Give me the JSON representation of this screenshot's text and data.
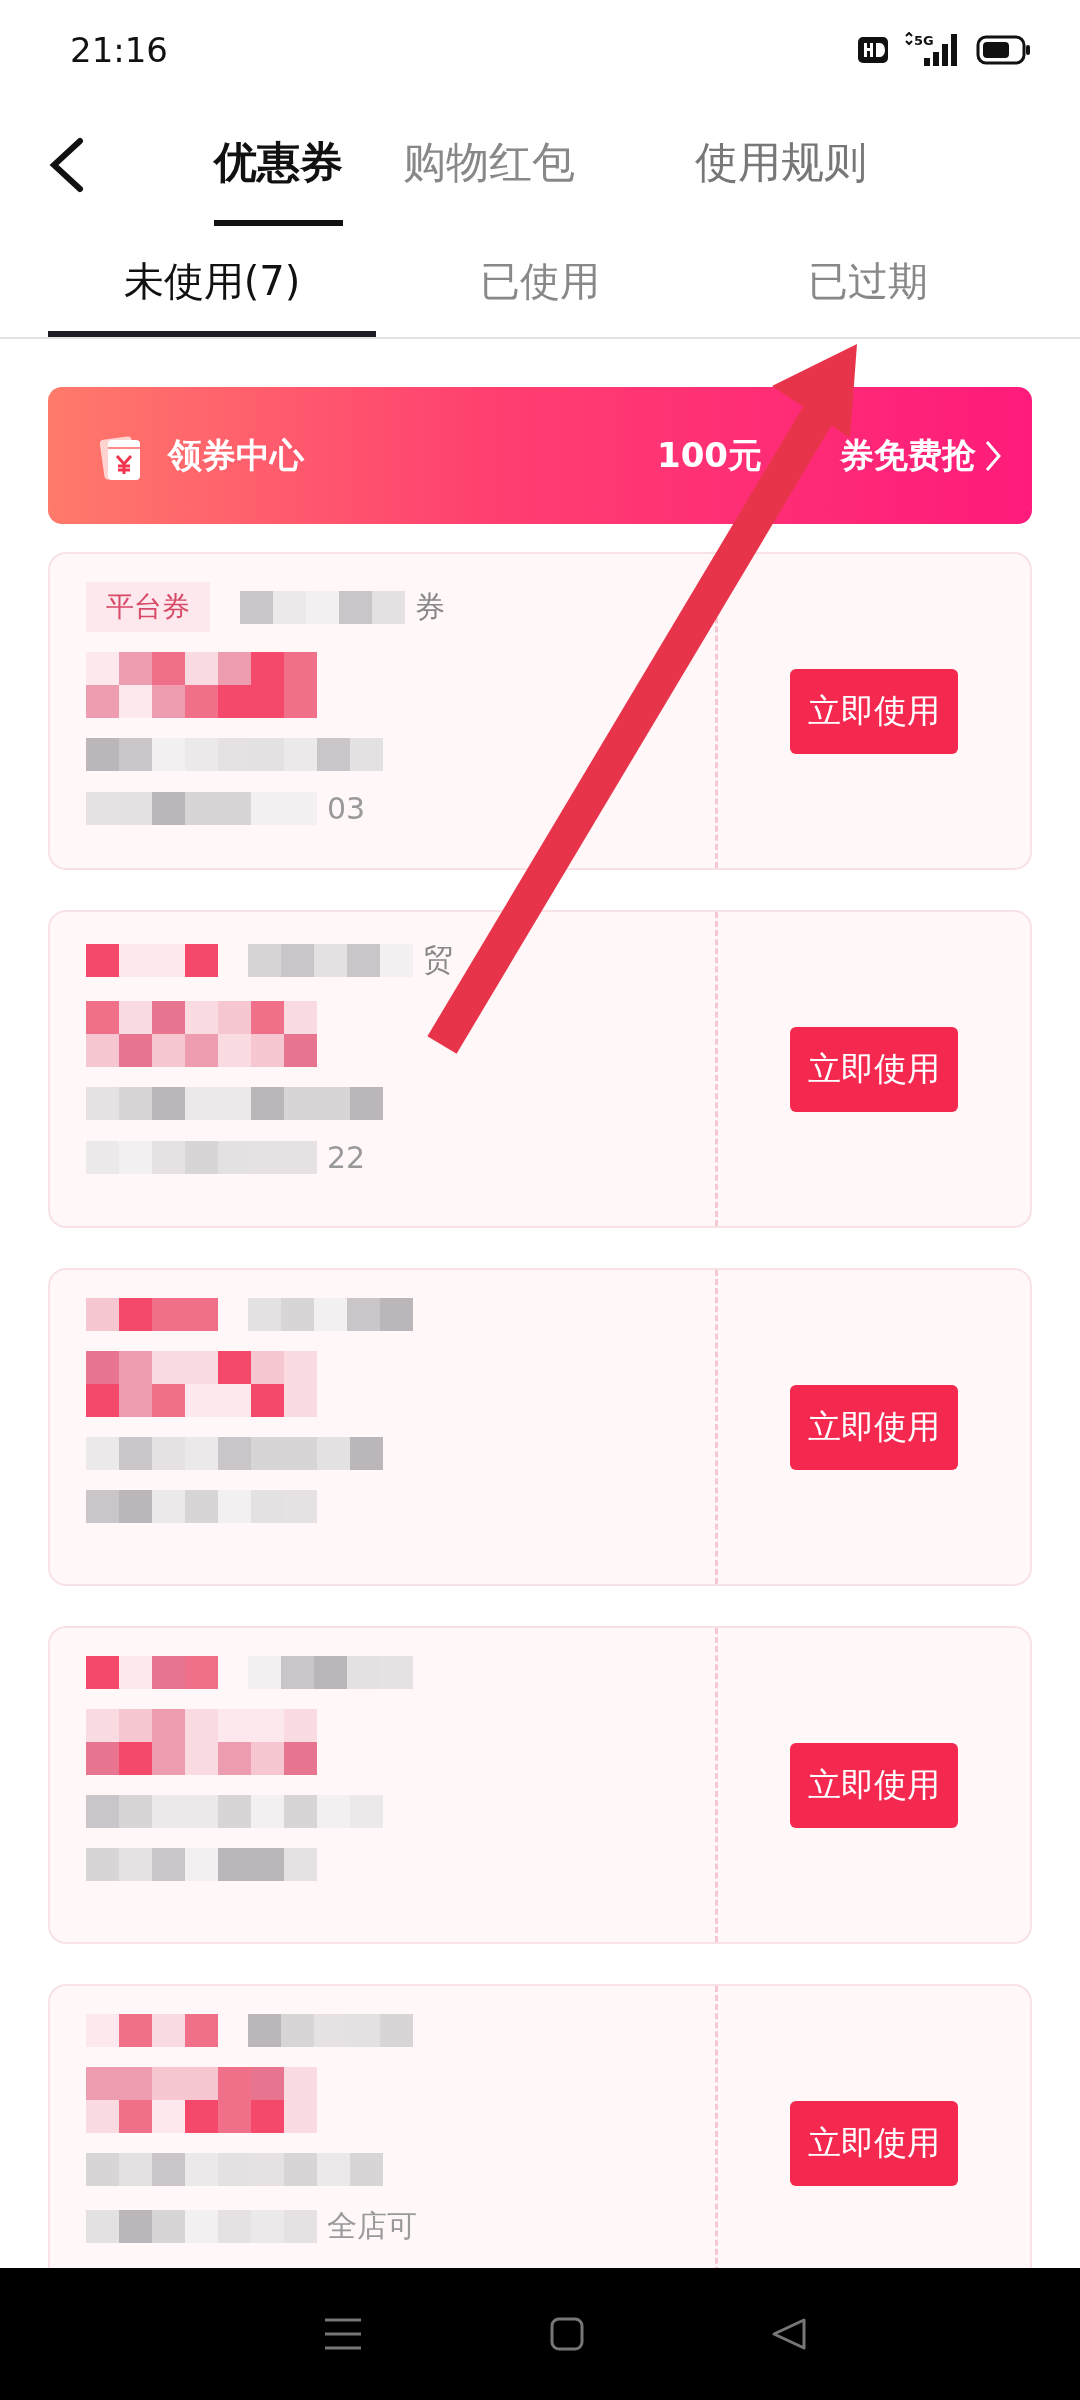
{
  "status_bar": {
    "time": "21:16",
    "network": "5G"
  },
  "header_tabs": [
    {
      "label": "优惠券",
      "selected": true
    },
    {
      "label": "购物红包",
      "selected": false
    },
    {
      "label": "使用规则",
      "selected": false
    }
  ],
  "sub_tabs": [
    {
      "label": "未使用(7)",
      "selected": true
    },
    {
      "label": "已使用",
      "selected": false
    },
    {
      "label": "已过期",
      "selected": false
    }
  ],
  "banner": {
    "title": "领券中心",
    "promo_start": "100元",
    "promo_end": "券免费抢"
  },
  "coupons": [
    {
      "tag": "平台券",
      "title_fragment": "券",
      "date_fragment": "03",
      "button": "立即使用"
    },
    {
      "title_fragment": "贸",
      "date_fragment": "22",
      "button": "立即使用"
    },
    {
      "button": "立即使用"
    },
    {
      "button": "立即使用"
    },
    {
      "note_fragment": "全店可",
      "button": "立即使用"
    }
  ]
}
